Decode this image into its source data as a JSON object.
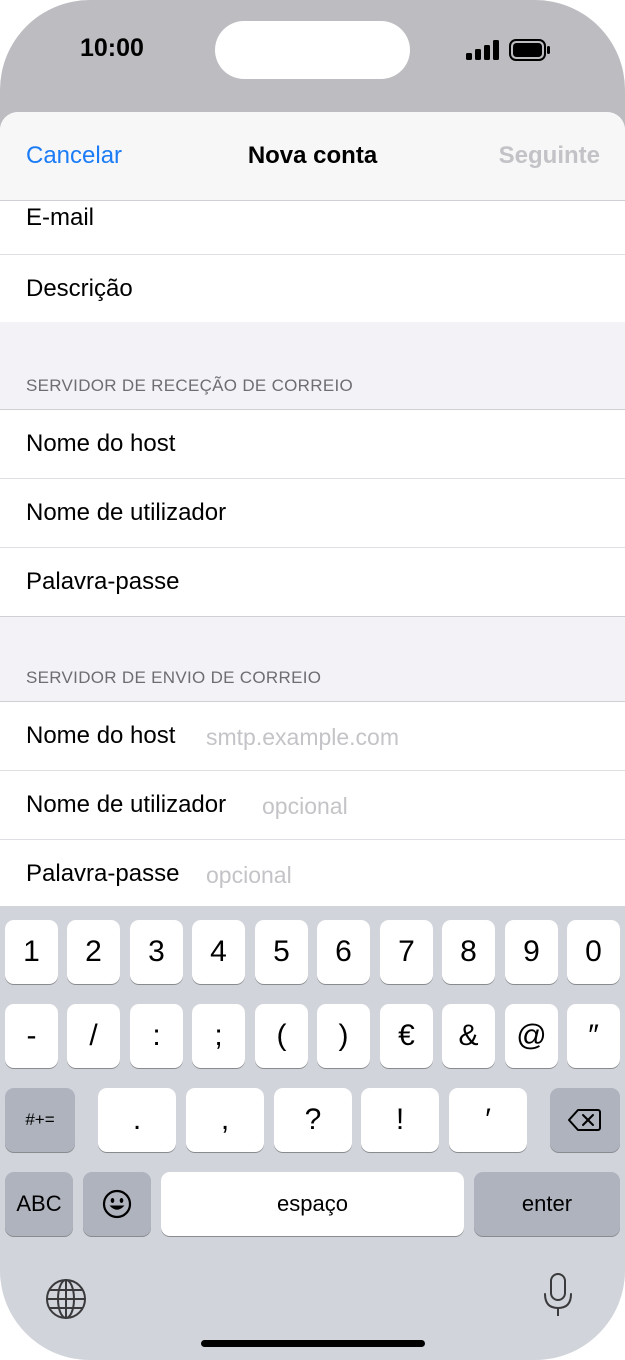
{
  "status_bar": {
    "time": "10:00"
  },
  "nav": {
    "cancel": "Cancelar",
    "title": "Nova conta",
    "next": "Seguinte"
  },
  "account": {
    "email_label": "E-mail",
    "description_label": "Descrição"
  },
  "incoming": {
    "header": "SERVIDOR DE RECEÇÃO DE CORREIO",
    "host_label": "Nome do host",
    "user_label": "Nome de utilizador",
    "password_label": "Palavra-passe"
  },
  "outgoing": {
    "header": "SERVIDOR DE ENVIO DE CORREIO",
    "host_label": "Nome do host",
    "host_placeholder": "smtp.example.com",
    "user_label": "Nome de utilizador",
    "user_placeholder": "opcional",
    "password_label": "Palavra-passe",
    "password_placeholder": "opcional"
  },
  "keyboard": {
    "row1": [
      "1",
      "2",
      "3",
      "4",
      "5",
      "6",
      "7",
      "8",
      "9",
      "0"
    ],
    "row2": [
      "-",
      "/",
      ":",
      ";",
      "(",
      ")",
      "€",
      "&",
      "@",
      "″"
    ],
    "row3": [
      ".",
      ",",
      "?",
      "!",
      "′"
    ],
    "symbols_key": "#+=",
    "abc_key": "ABC",
    "space_key": "espaço",
    "enter_key": "enter"
  },
  "icons": {
    "signal": "cellular-signal-icon",
    "battery": "battery-icon",
    "backspace": "backspace-icon",
    "emoji": "emoji-icon",
    "globe": "globe-icon",
    "mic": "microphone-icon"
  },
  "colors": {
    "accent": "#1b7cf6",
    "disabled": "#c3c3c7",
    "keyboard_bg": "#d1d4da"
  }
}
